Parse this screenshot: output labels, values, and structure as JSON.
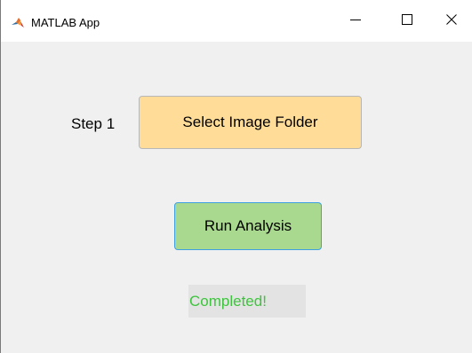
{
  "window": {
    "title": "MATLAB App",
    "icon": "matlab-logo-icon",
    "controls": {
      "minimize_icon": "minimize-icon",
      "maximize_icon": "maximize-icon",
      "close_icon": "close-icon"
    }
  },
  "main": {
    "step_label": "Step 1",
    "select_folder_label": "Select Image Folder",
    "run_analysis_label": "Run Analysis",
    "status_text": "Completed!"
  },
  "colors": {
    "select_folder_bg": "#ffdd99",
    "run_analysis_bg": "#a9d98e",
    "run_analysis_border": "#3ea0e0",
    "status_text": "#3dc43d",
    "window_bg": "#f0f0f0"
  }
}
